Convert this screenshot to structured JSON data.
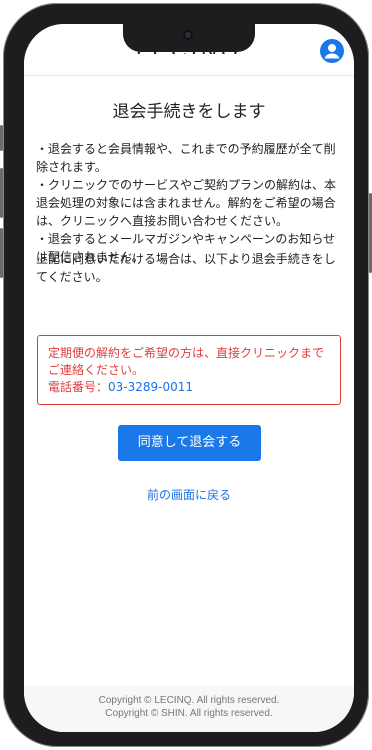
{
  "header": {
    "logo": "LECINQ",
    "account_icon": "user-circle-icon"
  },
  "page": {
    "title": "退会手続きをします",
    "notes": [
      "・退会すると会員情報や、これまでの予約履歴が全て削除されます。",
      "・クリニックでのサービスやご契約プランの解約は、本退会処理の対象には含まれません。解約をご希望の場合は、クリニックへ直接お問い合わせください。",
      "・退会するとメールマガジンやキャンペーンのお知らせは配信されません。"
    ],
    "agree_text": "上記に同意いただける場合は、以下より退会手続きをしてください。",
    "alert": {
      "message": "定期便の解約をご希望の方は、直接クリニックまでご連絡ください。",
      "tel_label": "電話番号：",
      "tel_number": "03-3289-0011"
    },
    "confirm_button": "同意して退会する",
    "back_link": "前の画面に戻る"
  },
  "footer": {
    "line1": "Copyright © LECINQ. All rights reserved.",
    "line2": "Copyright © SHIN. All rights reserved."
  },
  "colors": {
    "accent": "#1a78e8",
    "alert": "#e03d3d",
    "link": "#1a73e8"
  }
}
